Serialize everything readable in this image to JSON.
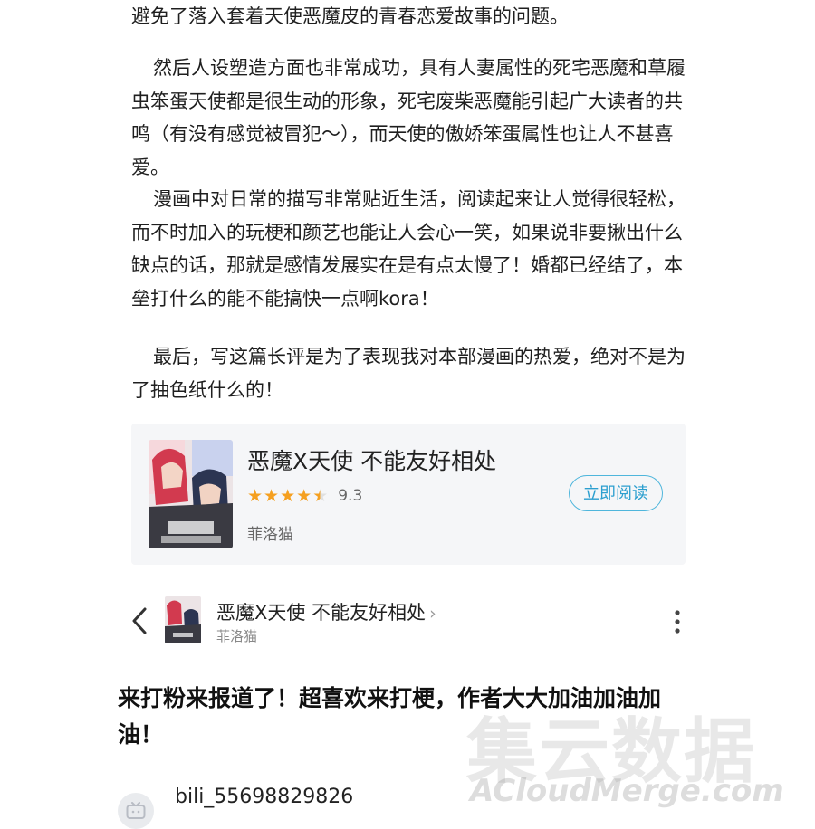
{
  "article": {
    "paragraphs": [
      "避免了落入套着天使恶魔皮的青春恋爱故事的问题。",
      "然后人设塑造方面也非常成功，具有人妻属性的死宅恶魔和草履虫笨蛋天使都是很生动的形象，死宅废柴恶魔能引起广大读者的共鸣（有没有感觉被冒犯～），而天使的傲娇笨蛋属性也让人不甚喜爱。",
      "漫画中对日常的描写非常贴近生活，阅读起来让人觉得很轻松，而不时加入的玩梗和颜艺也能让人会心一笑，如果说非要揪出什么缺点的话，那就是感情发展实在是有点太慢了！婚都已经结了，本垒打什么的能不能搞快一点啊kora！",
      "最后，写这篇长评是为了表现我对本部漫画的热爱，绝对不是为了抽色纸什么的！"
    ]
  },
  "comic_card": {
    "title": "恶魔X天使 不能友好相处",
    "rating": "9.3",
    "rating_stars": 4.5,
    "author": "菲洛猫",
    "read_button": "立即阅读",
    "cover_caption": "恶魔X天使 不能友好相处",
    "cover_icon": "comic-cover-image"
  },
  "navbar": {
    "title": "恶魔X天使 不能友好相处",
    "chevron": "›",
    "author": "菲洛猫",
    "back_icon": "chevron-left-icon",
    "more_icon": "more-vertical-icon"
  },
  "comment": {
    "text": "来打粉来报道了！超喜欢来打梗，作者大大加油加油加油！",
    "username": "bili_55698829826",
    "avatar_icon": "tv-avatar-icon"
  },
  "watermark": {
    "chinese": "集云数据",
    "english": "ACloudMerge.com"
  },
  "colors": {
    "accent": "#2c9fcf",
    "star": "#f5a020",
    "card_bg": "#f5f6f8"
  }
}
